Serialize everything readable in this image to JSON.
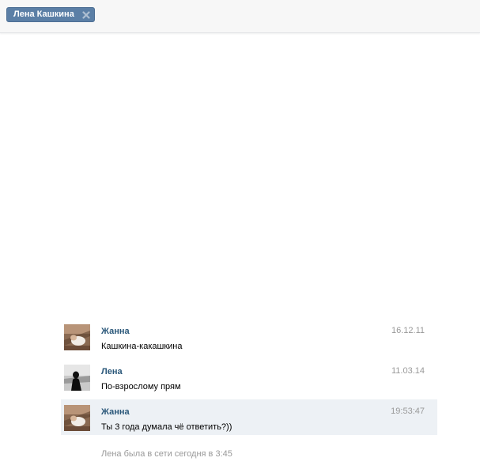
{
  "tab": {
    "label": "Лена Кашкина",
    "close_icon": "close-icon"
  },
  "colors": {
    "accent": "#5b7fa6",
    "author_link": "#2b587a",
    "muted": "#999999",
    "highlight_row": "#edf1f5"
  },
  "messages": [
    {
      "author": "Жанна",
      "text": "Кашкина-какашкина",
      "date": "16.12.11",
      "avatar_icon": "user-avatar-photo"
    },
    {
      "author": "Лена",
      "text": "По-взрослому прям",
      "date": "11.03.14",
      "avatar_icon": "user-avatar-photo"
    },
    {
      "author": "Жанна",
      "text": "Ты 3 года думала чё ответить?))",
      "date": "19:53:47",
      "avatar_icon": "user-avatar-photo"
    }
  ],
  "status": "Лена была в сети сегодня в 3:45"
}
